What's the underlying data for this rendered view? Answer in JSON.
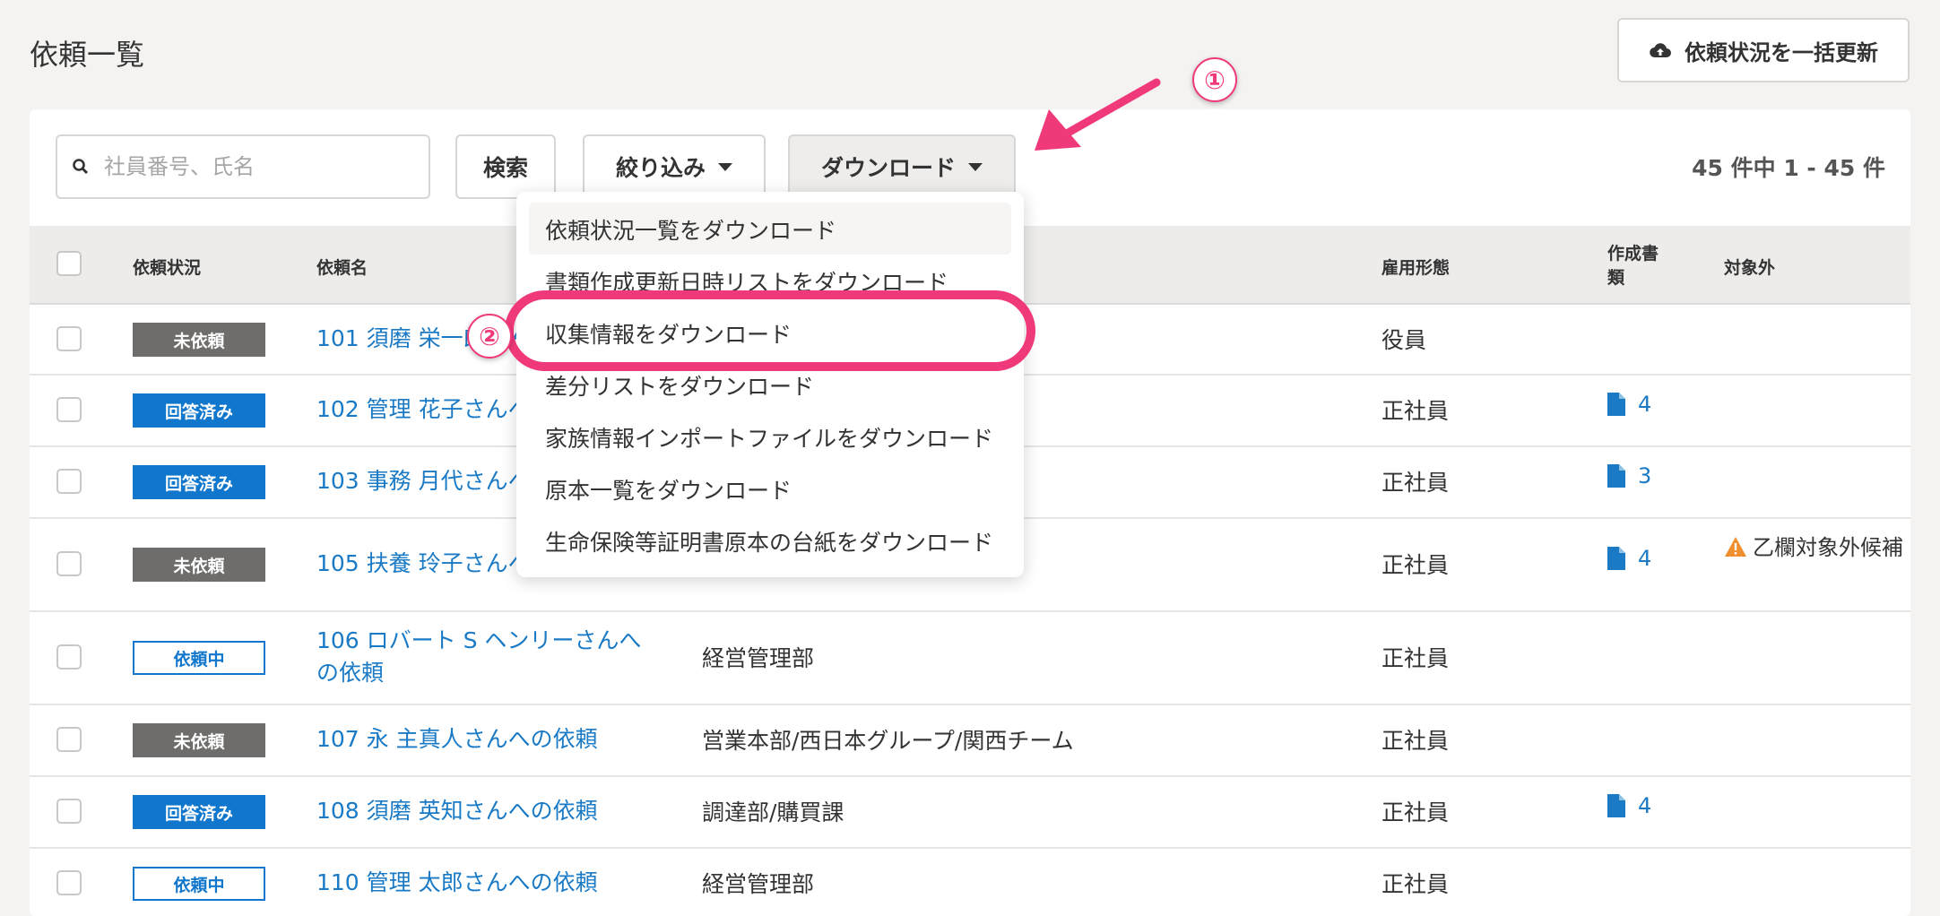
{
  "page": {
    "title": "依頼一覧"
  },
  "bulk_update": {
    "label": "依頼状況を一括更新",
    "icon": "cloud-upload-icon"
  },
  "search": {
    "placeholder": "社員番号、氏名",
    "icon": "search-icon"
  },
  "toolbar": {
    "search_label": "検索",
    "filter_label": "絞り込み",
    "download_label": "ダウンロード"
  },
  "count": "45 件中 1 - 45 件",
  "table": {
    "headers": {
      "status": "依頼状況",
      "name": "依頼名",
      "employment": "雇用形態",
      "docs_line1": "作成書",
      "docs_line2": "類",
      "excluded": "対象外"
    },
    "rows": [
      {
        "status": "未依頼",
        "name": "101 須磨 栄一郎さんへの依頼",
        "dept": "",
        "employment": "役員",
        "docs": "",
        "excluded": ""
      },
      {
        "status": "回答済み",
        "name": "102 管理 花子さんへの依頼",
        "dept": "",
        "employment": "正社員",
        "docs": "4",
        "excluded": ""
      },
      {
        "status": "回答済み",
        "name": "103 事務 月代さんへの依頼",
        "dept": "",
        "employment": "正社員",
        "docs": "3",
        "excluded": ""
      },
      {
        "status": "未依頼",
        "name": "105 扶養 玲子さんへの依頼",
        "dept": "",
        "employment": "正社員",
        "docs": "4",
        "excluded": "乙欄対象外候補"
      },
      {
        "status": "依頼中",
        "name_line1": "106 ロバート S ヘンリーさんへ",
        "name_line2": "の依頼",
        "dept": "経営管理部",
        "employment": "正社員",
        "docs": "",
        "excluded": ""
      },
      {
        "status": "未依頼",
        "name": "107 永 主真人さんへの依頼",
        "dept": "営業本部/西日本グループ/関西チーム",
        "employment": "正社員",
        "docs": "",
        "excluded": ""
      },
      {
        "status": "回答済み",
        "name": "108 須磨 英知さんへの依頼",
        "dept": "調達部/購買課",
        "employment": "正社員",
        "docs": "4",
        "excluded": ""
      },
      {
        "status": "依頼中",
        "name": "110 管理 太郎さんへの依頼",
        "dept": "経営管理部",
        "employment": "正社員",
        "docs": "",
        "excluded": ""
      }
    ]
  },
  "download_menu": {
    "items": [
      "依頼状況一覧をダウンロード",
      "書類作成更新日時リストをダウンロード",
      "収集情報をダウンロード",
      "差分リストをダウンロード",
      "家族情報インポートファイルをダウンロード",
      "原本一覧をダウンロード",
      "生命保険等証明書原本の台紙をダウンロード"
    ]
  },
  "annotations": {
    "step1": "①",
    "step2": "②",
    "color": "#f0397a"
  },
  "colors": {
    "accent": "#1177cc",
    "not_requested": "#6e6d6b",
    "warning": "#ef8f2f"
  }
}
